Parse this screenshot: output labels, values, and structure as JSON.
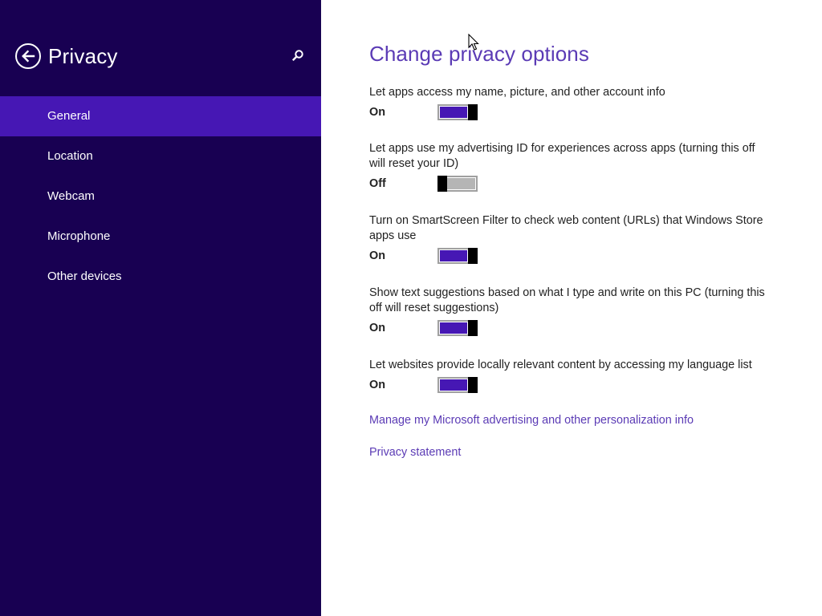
{
  "sidebar": {
    "title": "Privacy",
    "back_icon": "back-arrow-icon",
    "search_icon": "search-icon",
    "items": [
      {
        "label": "General",
        "selected": true
      },
      {
        "label": "Location",
        "selected": false
      },
      {
        "label": "Webcam",
        "selected": false
      },
      {
        "label": "Microphone",
        "selected": false
      },
      {
        "label": "Other devices",
        "selected": false
      }
    ],
    "colors": {
      "background": "#180052",
      "selected": "#4617b4"
    }
  },
  "main": {
    "title": "Change privacy options",
    "settings": [
      {
        "label": "Let apps access my name, picture, and other account info",
        "state": "On",
        "enabled": true
      },
      {
        "label": "Let apps use my advertising ID for experiences across apps (turning this off will reset your ID)",
        "state": "Off",
        "enabled": false
      },
      {
        "label": "Turn on SmartScreen Filter to check web content (URLs) that Windows Store apps use",
        "state": "On",
        "enabled": true
      },
      {
        "label": "Show text suggestions based on what I type and write on this PC (turning this off will reset suggestions)",
        "state": "On",
        "enabled": true
      },
      {
        "label": "Let websites provide locally relevant content by accessing my language list",
        "state": "On",
        "enabled": true
      }
    ],
    "links": {
      "manage": "Manage my Microsoft advertising and other personalization info",
      "privacy_statement": "Privacy statement"
    },
    "colors": {
      "accent": "#5b3bb5",
      "toggle_on": "#4617b4",
      "toggle_off": "#b5b5b5"
    }
  }
}
